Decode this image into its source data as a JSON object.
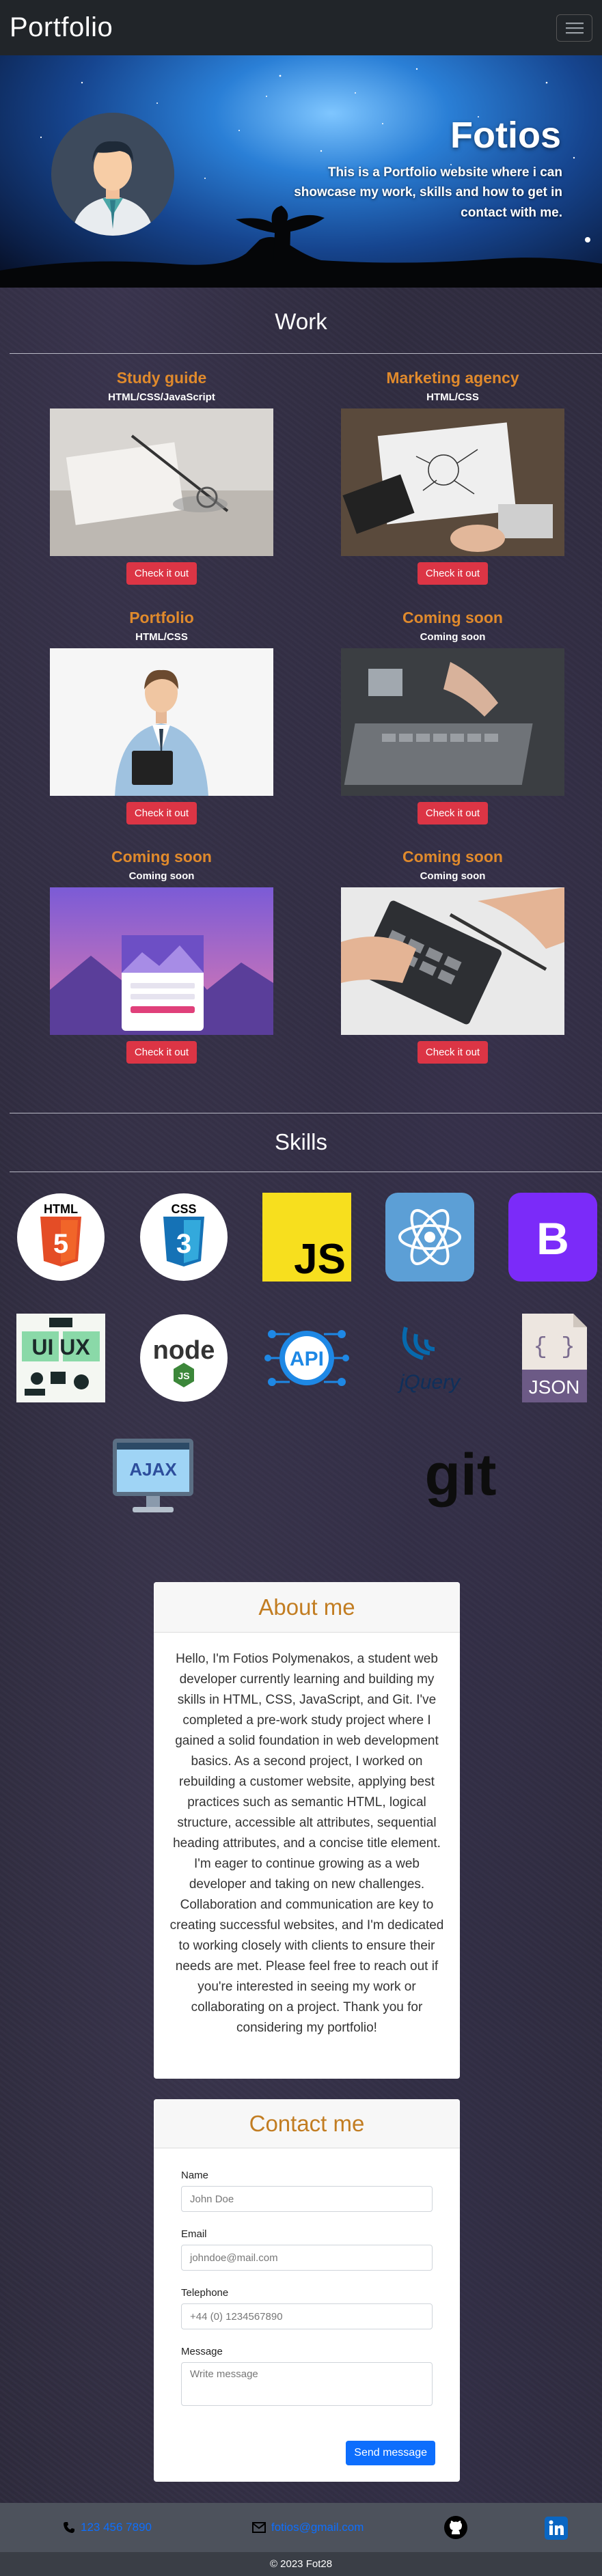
{
  "nav": {
    "brand": "Portfolio",
    "toggle_icon": "hamburger-menu-icon"
  },
  "hero": {
    "title": "Fotios",
    "subtitle": "This is a Portfolio website where i can showcase my work, skills and how to get in contact with me."
  },
  "work": {
    "title": "Work",
    "projects": [
      {
        "title": "Study guide",
        "tech": "HTML/CSS/JavaScript",
        "button": "Check it out",
        "image": "study-desk-photo"
      },
      {
        "title": "Marketing agency",
        "tech": "HTML/CSS",
        "button": "Check it out",
        "image": "marketing-desk-photo"
      },
      {
        "title": "Portfolio",
        "tech": "HTML/CSS",
        "button": "Check it out",
        "image": "businessman-photo"
      },
      {
        "title": "Coming soon",
        "tech": "Coming soon",
        "button": "Check it out",
        "image": "laptop-typing-photo"
      },
      {
        "title": "Coming soon",
        "tech": "Coming soon",
        "button": "Check it out",
        "image": "login-screen-illustration"
      },
      {
        "title": "Coming soon",
        "tech": "Coming soon",
        "button": "Check it out",
        "image": "calculator-photo"
      }
    ]
  },
  "skills": {
    "title": "Skills",
    "items": [
      {
        "name": "html5-icon",
        "label": "HTML"
      },
      {
        "name": "css3-icon",
        "label": "CSS"
      },
      {
        "name": "javascript-icon",
        "label": "JS"
      },
      {
        "name": "react-icon"
      },
      {
        "name": "bootstrap-icon",
        "label": "B"
      },
      {
        "name": "ui-ux-icon",
        "label": "UI UX"
      },
      {
        "name": "nodejs-icon",
        "label": "node"
      },
      {
        "name": "api-icon",
        "label": "API"
      },
      {
        "name": "jquery-icon",
        "label": "jQuery"
      },
      {
        "name": "json-icon",
        "label": "JSON"
      },
      {
        "name": "ajax-icon",
        "label": "AJAX"
      },
      {
        "name": "git-icon",
        "label": "git"
      }
    ]
  },
  "about": {
    "title": "About me",
    "paragraph1": "Hello, I'm Fotios Polymenakos, a student web developer currently learning and building my skills in HTML, CSS, JavaScript, and Git. I've completed a pre-work study project where I gained a solid foundation in web development basics. As a second project, I worked on rebuilding a customer website, applying best practices such as semantic HTML, logical structure, accessible alt attributes, sequential heading attributes, and a concise title element.",
    "paragraph2": "I'm eager to continue growing as a web developer and taking on new challenges. Collaboration and communication are key to creating successful websites, and I'm dedicated to working closely with clients to ensure their needs are met. Please feel free to reach out if you're interested in seeing my work or collaborating on a project. Thank you for considering my portfolio!"
  },
  "contact": {
    "title": "Contact me",
    "name_label": "Name",
    "name_placeholder": "John Doe",
    "email_label": "Email",
    "email_placeholder": "johndoe@mail.com",
    "phone_label": "Telephone",
    "phone_placeholder": "+44 (0) 1234567890",
    "message_label": "Message",
    "message_placeholder": "Write message",
    "send_button": "Send message"
  },
  "footer": {
    "phone": "123 456 7890",
    "email": "fotios@gmail.com",
    "copyright": "© 2023 Fot28"
  },
  "colors": {
    "accent_orange": "#e08a2c",
    "button_red": "#dc3545",
    "button_blue": "#0d6efd",
    "nav_dark": "#212529"
  }
}
